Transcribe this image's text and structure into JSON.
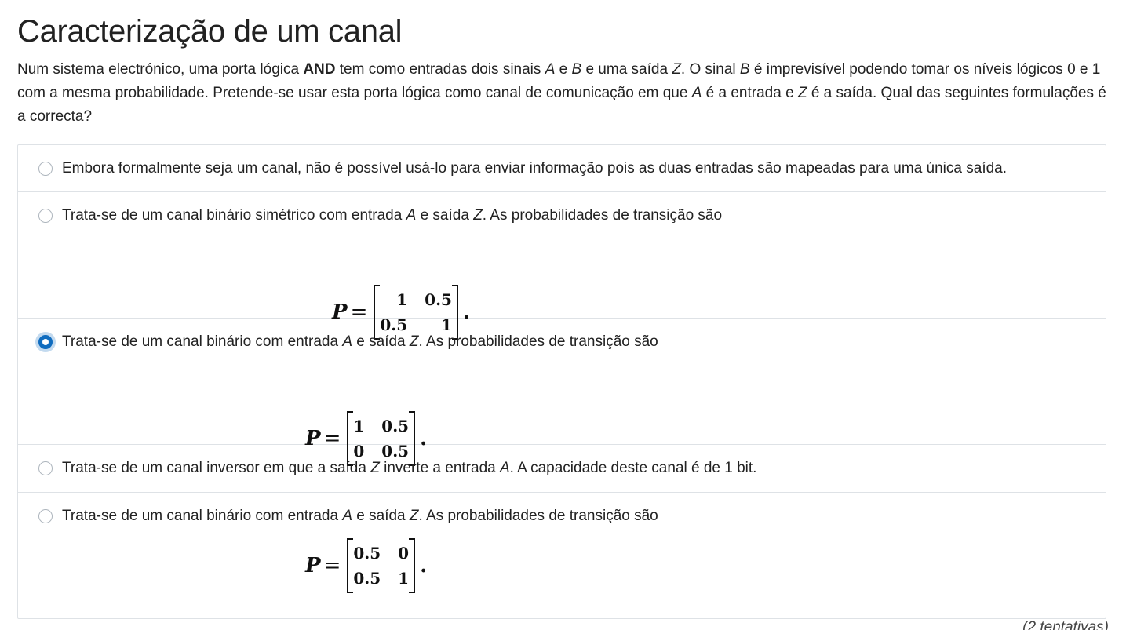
{
  "question": {
    "title": "Caracterização de um canal",
    "stem": {
      "p1": "Num sistema electrónico, uma porta lógica ",
      "and": "AND",
      "p2": " tem como entradas dois sinais ",
      "a": "A",
      "p3": " e ",
      "b": "B",
      "p4": " e uma saída ",
      "z": "Z",
      "p5": ". O sinal ",
      "b2": "B",
      "p6": " é imprevisível podendo tomar os níveis lógicos 0 e 1 com a mesma probabilidade. Pretende-se usar esta porta lógica como canal de comunicação em que ",
      "a2": "A",
      "p7": " é a entrada e ",
      "z2": "Z",
      "p8": " é a saída. Qual das seguintes formulações é a correcta?"
    }
  },
  "options": [
    {
      "text": "Embora formalmente seja um canal, não é possível usá-lo para enviar informação pois as duas entradas são mapeadas para uma única saída.",
      "selected": false
    },
    {
      "pre": "Trata-se de um canal binário simétrico com entrada ",
      "a": "A",
      "mid": " e saída ",
      "z": "Z",
      "post": ". As probabilidades de transição são",
      "matrix": {
        "p": "P",
        "eq": "=",
        "cells": [
          "1",
          "0.5",
          "0.5",
          "1"
        ],
        "dot": "."
      },
      "selected": false
    },
    {
      "pre": "Trata-se de um canal binário com entrada ",
      "a": "A",
      "mid": " e saída ",
      "z": "Z",
      "post": ". As probabilidades de transição são",
      "matrix": {
        "p": "P",
        "eq": "=",
        "cells": [
          "1",
          "0.5",
          "0",
          "0.5"
        ],
        "dot": "."
      },
      "selected": true
    },
    {
      "pre": "Trata-se de um canal inversor em que a saída ",
      "z": "Z",
      "mid": " inverte a entrada ",
      "a": "A",
      "post": ". A capacidade deste canal é de 1 bit.",
      "selected": false
    },
    {
      "pre": "Trata-se de um canal binário com entrada ",
      "a": "A",
      "mid": " e saída ",
      "z": "Z",
      "post": ". As probabilidades de transição são",
      "matrix": {
        "p": "P",
        "eq": "=",
        "cells": [
          "0.5",
          "0",
          "0.5",
          "1"
        ],
        "dot": "."
      },
      "selected": false
    }
  ],
  "footer": {
    "attempts": "(2 tentativas)"
  },
  "colors": {
    "accent": "#0f6cbf",
    "border": "#dee2e6",
    "text": "#222222"
  }
}
